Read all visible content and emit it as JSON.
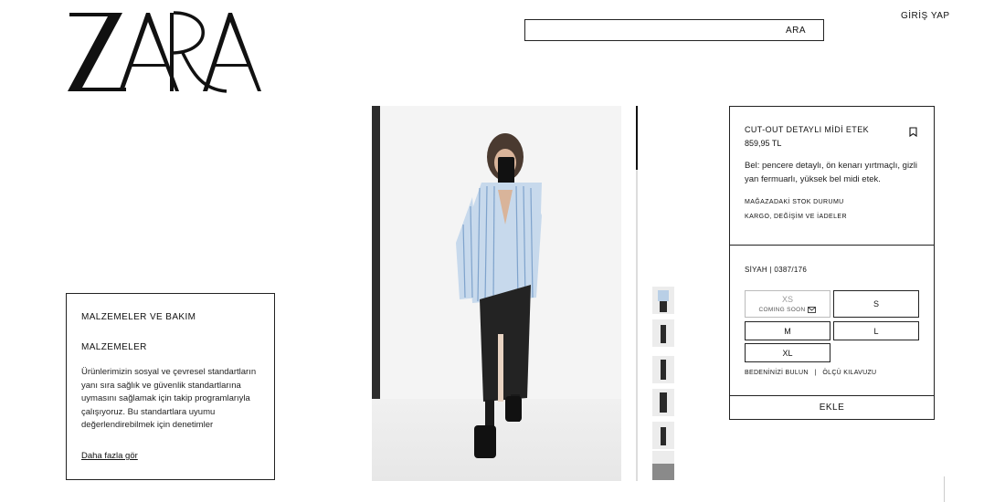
{
  "brand": {
    "logo_text": "ZARA"
  },
  "header": {
    "search_button": "ARA",
    "search_placeholder": "",
    "login": "GİRİŞ YAP"
  },
  "materials": {
    "heading": "MALZEMELER VE BAKIM",
    "subheading": "MALZEMELER",
    "body": "Ürünlerimizin sosyal ve çevresel standartların yanı sıra sağlık ve güvenlik standartlarına uymasını sağlamak için takip programlarıyla çalışıyoruz. Bu standartlara uyumu değerlendirebilmek için denetimler gerçekleştiriyor ve sürekli",
    "more_link": "Daha fazla gör"
  },
  "product": {
    "title": "CUT-OUT DETAYLI MİDİ ETEK",
    "price": "859,95 TL",
    "description": "Bel: pencere detaylı, ön kenarı yırtmaçlı, gizli yan fermuarlı, yüksek bel midi etek.",
    "stock_link": "MAĞAZADAKİ STOK DURUMU",
    "shipping_link": "KARGO, DEĞİŞİM VE İADELER",
    "color_ref": "SİYAH | 0387/176",
    "sizes": [
      {
        "label": "XS",
        "note": "COMING SOON",
        "available": false
      },
      {
        "label": "S",
        "available": true
      },
      {
        "label": "M",
        "available": true
      },
      {
        "label": "L",
        "available": true
      },
      {
        "label": "XL",
        "available": true
      }
    ],
    "size_finder": "BEDENİNİZİ BULUN",
    "separator": "|",
    "size_guide": "ÖLÇÜ KILAVUZU",
    "add_button": "EKLE"
  },
  "icons": {
    "bookmark": "bookmark-icon",
    "mail": "mail-icon"
  },
  "colors": {
    "text": "#111111",
    "border": "#222222",
    "background": "#ffffff"
  }
}
